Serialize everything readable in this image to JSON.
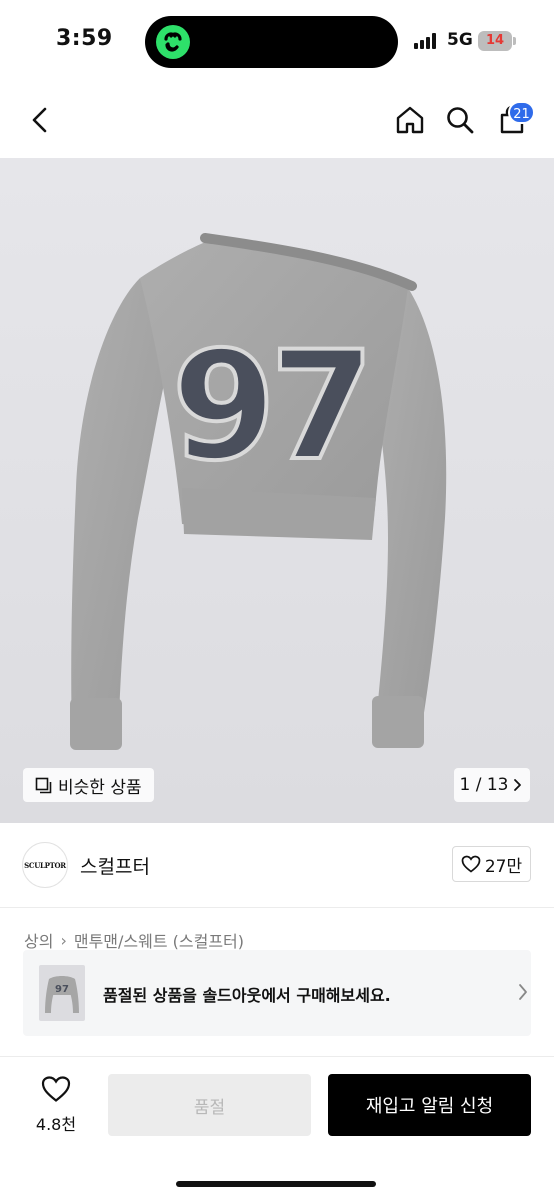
{
  "status_bar": {
    "time": "3:59",
    "network": "5G",
    "battery": "14"
  },
  "top_nav": {
    "cart_badge": "21",
    "icons": [
      "back-icon",
      "home-icon",
      "search-icon",
      "cart-icon"
    ]
  },
  "product_image": {
    "print_number": "97",
    "similar_label": "비슷한 상품",
    "page_counter": "1 / 13"
  },
  "brand": {
    "logo_text": "SCULPTOR",
    "name": "스컬프터",
    "likes": "27만"
  },
  "breadcrumb": {
    "items": [
      "상의",
      "맨투맨/스웨트 (스컬프터)"
    ]
  },
  "soldout_banner": {
    "text": "품절된 상품을 솔드아웃에서 구매해보세요."
  },
  "bottom_bar": {
    "wish_count": "4.8천",
    "soldout_label": "품절",
    "restock_label": "재입고 알림 신청"
  },
  "colors": {
    "accent_badge": "#2f6bea",
    "battery_low": "#e53935",
    "primary_button": "#000000",
    "disabled_button": "#ececec"
  }
}
